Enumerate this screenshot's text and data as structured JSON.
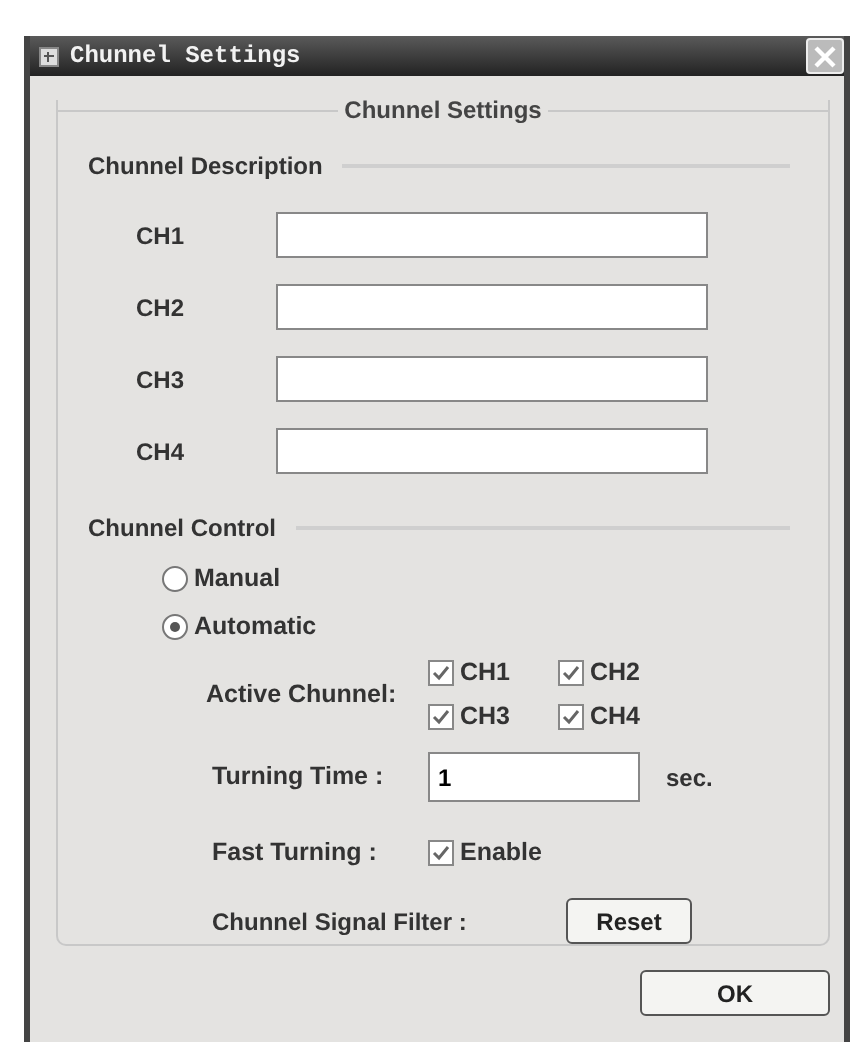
{
  "window": {
    "title": "Chunnel Settings"
  },
  "group": {
    "title": "Chunnel Settings"
  },
  "description": {
    "title": "Chunnel Description",
    "channels": [
      {
        "label": "CH1"
      },
      {
        "label": "CH2"
      },
      {
        "label": "CH3"
      },
      {
        "label": "CH4"
      }
    ]
  },
  "control": {
    "title": "Chunnel Control",
    "modes": [
      {
        "label": "Manual",
        "selected": false
      },
      {
        "label": "Automatic",
        "selected": true
      }
    ],
    "active_channels": {
      "label": "Active  Chunnel:",
      "items": [
        {
          "label": "CH1",
          "checked": true
        },
        {
          "label": "CH2",
          "checked": true
        },
        {
          "label": "CH3",
          "checked": true
        },
        {
          "label": "CH4",
          "checked": true
        }
      ]
    },
    "turning_time": {
      "label": "Turning Time  :",
      "value": "1",
      "unit": "sec."
    },
    "fast_turning": {
      "label": "Fast Turning  :",
      "option": {
        "label": "Enable",
        "checked": true
      }
    },
    "signal_filter": {
      "label": "Chunnel Signal Filter :",
      "button": "Reset"
    }
  },
  "buttons": [
    "OK"
  ]
}
